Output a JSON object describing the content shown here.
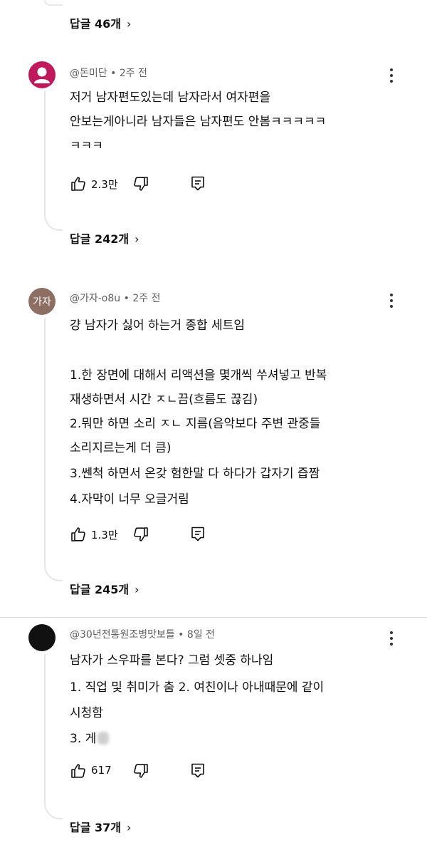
{
  "thread0": {
    "replies_label": "답글 46개",
    "chevron": "›"
  },
  "comments": [
    {
      "author": "@돈미단",
      "time": "2주 전",
      "avatar_color": "#c1185b",
      "lines": [
        "저거 남자편도있는데 남자라서 여자편을",
        "안보는게아니라 남자들은 남자편도 안봄ㅋㅋㅋㅋㅋ",
        "ㅋㅋㅋ"
      ],
      "likes": "2.3만",
      "replies_label": "답글 242개"
    },
    {
      "author": "@가자-o8u",
      "time": "2주 전",
      "avatar_text": "가자",
      "avatar_color": "#8d6e63",
      "lines": [
        "걍 남자가 싫어 하는거 종합 세트임",
        "",
        "1.한 장면에 대해서 리액션을 몇개씩 쑤셔넣고 반복",
        "재생하면서 시간 ㅈㄴ끔(흐름도 끊김)",
        "2.뭐만 하면 소리 ㅈㄴ 지름(음악보다 주변 관중들",
        "소리지르는게 더 큼)",
        "3.쎈척 하면서 온갖 험한말 다 하다가 갑자기 즙짬",
        "4.자막이 너무 오글거림"
      ],
      "likes": "1.3만",
      "replies_label": "답글 245개"
    },
    {
      "author": "@30년전통원조병맛보틀",
      "time": "8일 전",
      "avatar_color": "#111111",
      "lines": [
        "남자가 스우파를 본다? 그럼 셋중 하나임",
        "1. 직업 및 취미가 춤  2. 여친이나 아내때문에 같이",
        "시청함",
        "3. 게"
      ],
      "likes": "617",
      "replies_label": "답글 37개"
    }
  ]
}
